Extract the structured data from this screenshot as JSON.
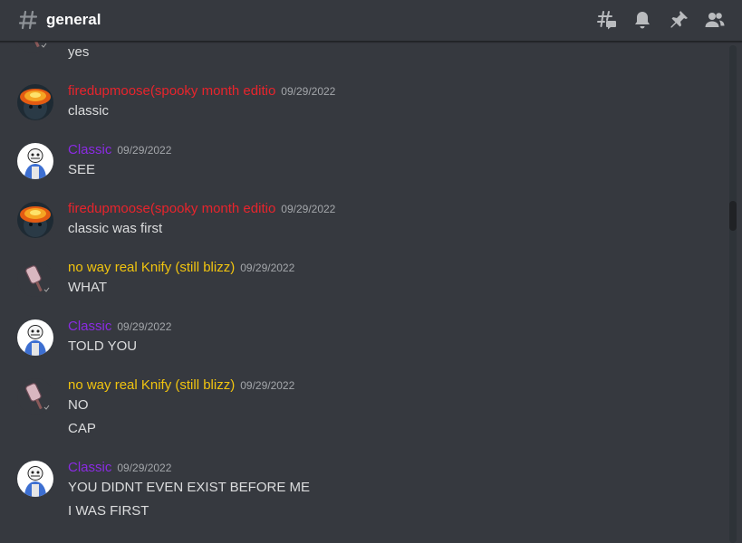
{
  "header": {
    "channel_name": "general",
    "icons": [
      "threads-icon",
      "bell-icon",
      "pin-icon",
      "member-list-icon"
    ]
  },
  "colors": {
    "firedupmoose": "#e8242c",
    "classic": "#8a2be2",
    "knify": "#f1c40f",
    "text": "#dcddde",
    "timestamp": "#a3a6aa"
  },
  "messages": [
    {
      "lines": [
        "yes"
      ]
    },
    {
      "author": "firedupmoose(spooky month editio",
      "timestamp": "09/29/2022",
      "lines": [
        "classic"
      ]
    },
    {
      "author": "Classic",
      "timestamp": "09/29/2022",
      "lines": [
        "SEE"
      ]
    },
    {
      "author": "firedupmoose(spooky month editio",
      "timestamp": "09/29/2022",
      "lines": [
        "classic was first"
      ]
    },
    {
      "author": "no way real Knify (still blizz)",
      "timestamp": "09/29/2022",
      "lines": [
        "WHAT"
      ]
    },
    {
      "author": "Classic",
      "timestamp": "09/29/2022",
      "lines": [
        "TOLD YOU"
      ]
    },
    {
      "author": "no way real Knify (still blizz)",
      "timestamp": "09/29/2022",
      "lines": [
        "NO",
        "CAP"
      ]
    },
    {
      "author": "Classic",
      "timestamp": "09/29/2022",
      "lines": [
        "YOU DIDNT EVEN EXIST BEFORE ME",
        "I WAS FIRST"
      ]
    }
  ]
}
